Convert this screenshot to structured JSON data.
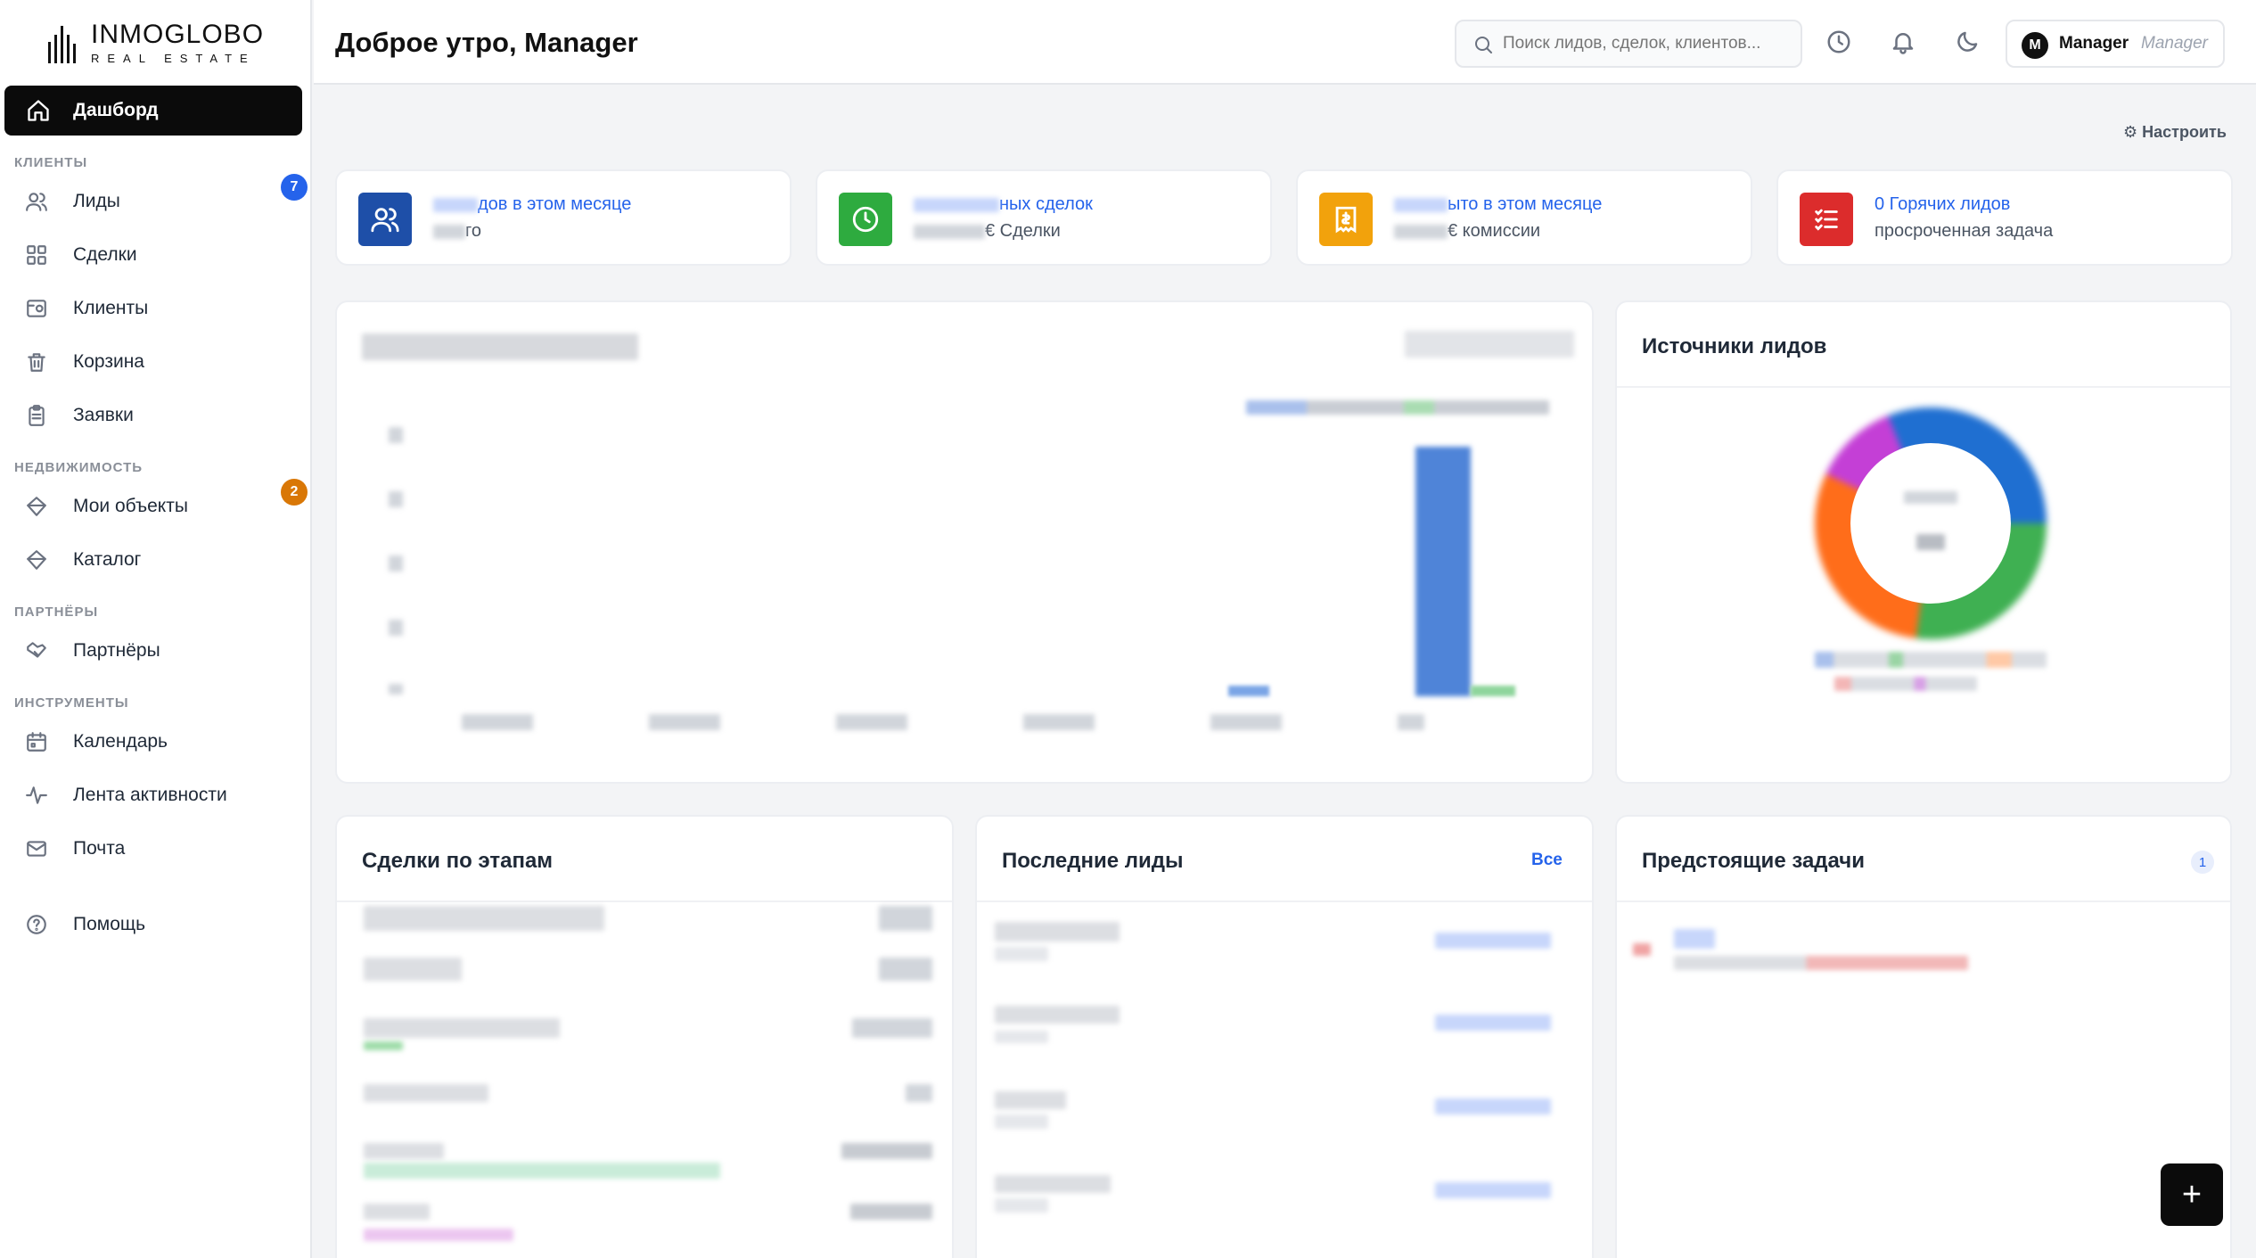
{
  "brand": {
    "name": "INMOGLOBO",
    "sub": "REAL ESTATE"
  },
  "sidebar": {
    "active": {
      "label": "Дашборд",
      "icon": "home-icon"
    },
    "sections": [
      {
        "title": "КЛИЕНТЫ"
      },
      {
        "title": "НЕДВИЖИМОСТЬ"
      },
      {
        "title": "ПАРТНЁРЫ"
      },
      {
        "title": "ИНСТРУМЕНТЫ"
      }
    ],
    "items": [
      {
        "label": "Лиды",
        "icon": "users-icon",
        "badge": "7"
      },
      {
        "label": "Сделки",
        "icon": "grid-icon"
      },
      {
        "label": "Клиенты",
        "icon": "contact-icon"
      },
      {
        "label": "Корзина",
        "icon": "trash-icon"
      },
      {
        "label": "Заявки",
        "icon": "clipboard-icon"
      },
      {
        "label": "Мои объекты",
        "icon": "diamond-icon",
        "badge": "2"
      },
      {
        "label": "Каталог",
        "icon": "diamond-icon"
      },
      {
        "label": "Партнёры",
        "icon": "handshake-icon"
      },
      {
        "label": "Календарь",
        "icon": "calendar-icon"
      },
      {
        "label": "Лента активности",
        "icon": "activity-icon"
      },
      {
        "label": "Почта",
        "icon": "mail-icon"
      },
      {
        "label": "Помощь",
        "icon": "help-icon"
      }
    ],
    "badge_colors": {
      "leads": "#2563eb",
      "objects": "#d97706"
    }
  },
  "header": {
    "greeting": "Доброе утро, Manager",
    "search_placeholder": "Поиск лидов, сделок, клиентов...",
    "user": {
      "initial": "M",
      "name": "Manager",
      "role": "Manager"
    }
  },
  "configure_label": "⚙ Настроить",
  "stats": [
    {
      "line1": "дов в этом месяце",
      "line2": "го",
      "color": "#1e4fa8",
      "icon": "users-icon"
    },
    {
      "line1": "ных сделок",
      "line2": "€ Сделки",
      "color": "#2eab3f",
      "icon": "clock-icon"
    },
    {
      "line1": "ыто в этом месяце",
      "line2": "€ комиссии",
      "color": "#f2a20c",
      "icon": "receipt-icon"
    },
    {
      "line1": "0 Горячих лидов",
      "line2": "просроченная задача",
      "color": "#dc2c2c",
      "icon": "checklist-icon"
    }
  ],
  "panels": {
    "sources_title": "Источники лидов",
    "deals_title": "Сделки по этапам",
    "leads_title": "Последние лиды",
    "leads_all": "Все",
    "tasks_title": "Предстоящие задачи",
    "tasks_count": "1"
  },
  "colors": {
    "accent": "#2563eb",
    "dark": "#0b0b0b"
  },
  "fab_label": "+"
}
